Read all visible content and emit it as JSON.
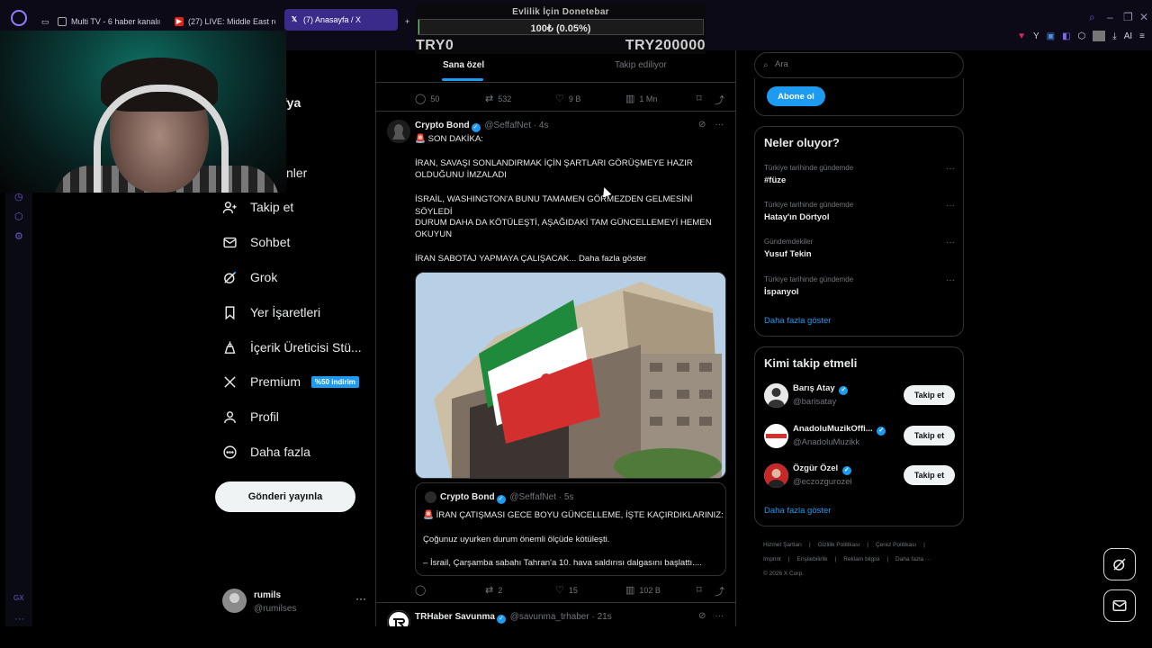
{
  "browser": {
    "tabs": [
      {
        "label": "Multi TV - 6 haber kanalını",
        "icon": "page-icon"
      },
      {
        "label": "(27) LIVE: Middle East real",
        "icon": "youtube-icon"
      },
      {
        "label": "(7) Anasayfa / X",
        "icon": "x-icon"
      }
    ],
    "new_tab": "+",
    "toolbar_ai": "AI"
  },
  "donation": {
    "title": "Evlilik İçin Donetebar",
    "amount": "100₺ (0.05%)",
    "progress_fraction": 0.0005,
    "min_label": "TRY0",
    "max_label": "TRY200000"
  },
  "nav": {
    "partial_label": "fya",
    "partial_label2": "nler",
    "items": [
      {
        "label": "Takip et",
        "icon": "follow-icon"
      },
      {
        "label": "Sohbet",
        "icon": "mail-icon"
      },
      {
        "label": "Grok",
        "icon": "grok-icon"
      },
      {
        "label": "Yer İşaretleri",
        "icon": "bookmark-icon"
      },
      {
        "label": "İçerik Üreticisi Stü...",
        "icon": "creator-icon"
      },
      {
        "label": "Premium",
        "icon": "x-logo-icon"
      },
      {
        "label": "Profil",
        "icon": "profile-icon"
      },
      {
        "label": "Daha fazla",
        "icon": "more-circle-icon"
      }
    ],
    "premium_badge": "%50 indirim",
    "post_button": "Gönderi yayınla",
    "sidebar_label": "GX"
  },
  "account": {
    "name": "rumils",
    "handle": "@rumilses",
    "more": "···"
  },
  "timeline": {
    "tabs": [
      {
        "label": "Sana özel"
      },
      {
        "label": "Takip ediliyor"
      }
    ],
    "top_actions": {
      "replies": "50",
      "reposts": "532",
      "likes": "9 B",
      "views": "1 Mn"
    },
    "tweet1": {
      "name": "Crypto Bond",
      "handle": "@SeffafNet",
      "time": "· 4s",
      "lines": [
        "🚨 SON DAKİKA:",
        "İRAN, SAVAŞI SONLANDIRMAK İÇİN ŞARTLARI GÖRÜŞMEYE HAZIR",
        "OLDUĞUNU İMZALADI",
        "İSRAİL, WASHINGTON'A BUNU TAMAMEN GÖRMEZDEN GELMESİNİ SÖYLEDİ",
        "DURUM DAHA DA KÖTÜLEŞTİ, AŞAĞIDAKİ TAM GÜNCELLEMEYİ HEMEN",
        "OKUYUN",
        "İRAN SABOTAJ YAPMAYA ÇALIŞACAK..."
      ],
      "show_more": "Daha fazla göster",
      "quote": {
        "name": "Crypto Bond",
        "handle": "@SeffafNet",
        "time": "· 5s",
        "lines": [
          "🚨 İRAN ÇATIŞMASI GECE BOYU GÜNCELLEME, İŞTE KAÇIRDIKLARINIZ:",
          "Çoğunuz uyurken durum önemli ölçüde kötüleşti.",
          "– İsrail, Çarşamba sabahı Tahran'a 10. hava saldırısı dalgasını başlattı...."
        ]
      },
      "actions": {
        "replies": "",
        "reposts": "2",
        "likes": "15",
        "views": "102 B"
      }
    },
    "tweet2": {
      "name": "TRHaber Savunma",
      "handle": "@savunma_trhaber",
      "time": "· 21s"
    }
  },
  "right": {
    "search_placeholder": "Ara",
    "subscribe": "Abone ol",
    "trends_title": "Neler oluyor?",
    "trends": [
      {
        "context": "Türkiye tarihinde gündemde",
        "name": "#füze"
      },
      {
        "context": "Türkiye tarihinde gündemde",
        "name": "Hatay'ın Dörtyol"
      },
      {
        "context": "Gündemdekiler",
        "name": "Yusuf Tekin"
      },
      {
        "context": "Türkiye tarihinde gündemde",
        "name": "İspanyol"
      }
    ],
    "trends_more": "Daha fazla göster",
    "wtf_title": "Kimi takip etmeli",
    "wtf": [
      {
        "name": "Barış Atay",
        "handle": "@barisatay",
        "button": "Takip et"
      },
      {
        "name": "AnadoluMuzikOffi...",
        "handle": "@AnadoluMuzikk",
        "button": "Takip et"
      },
      {
        "name": "Özgür Özel",
        "handle": "@eczozgurozel",
        "button": "Takip et"
      }
    ],
    "wtf_more": "Daha fazla göster",
    "footer": [
      "Hizmet Şartları",
      "|",
      "Gizlilik Politikası",
      "|",
      "Çerez Politikası",
      "|",
      "Imprint",
      "|",
      "Erişilebilirlik",
      "|",
      "Reklam bilgisi",
      "|",
      "Daha fazla ···",
      "© 2026 X Corp."
    ]
  },
  "colors": {
    "accent": "#1d9bf0",
    "browser_accent": "#3a2a8a",
    "background": "#000000"
  }
}
